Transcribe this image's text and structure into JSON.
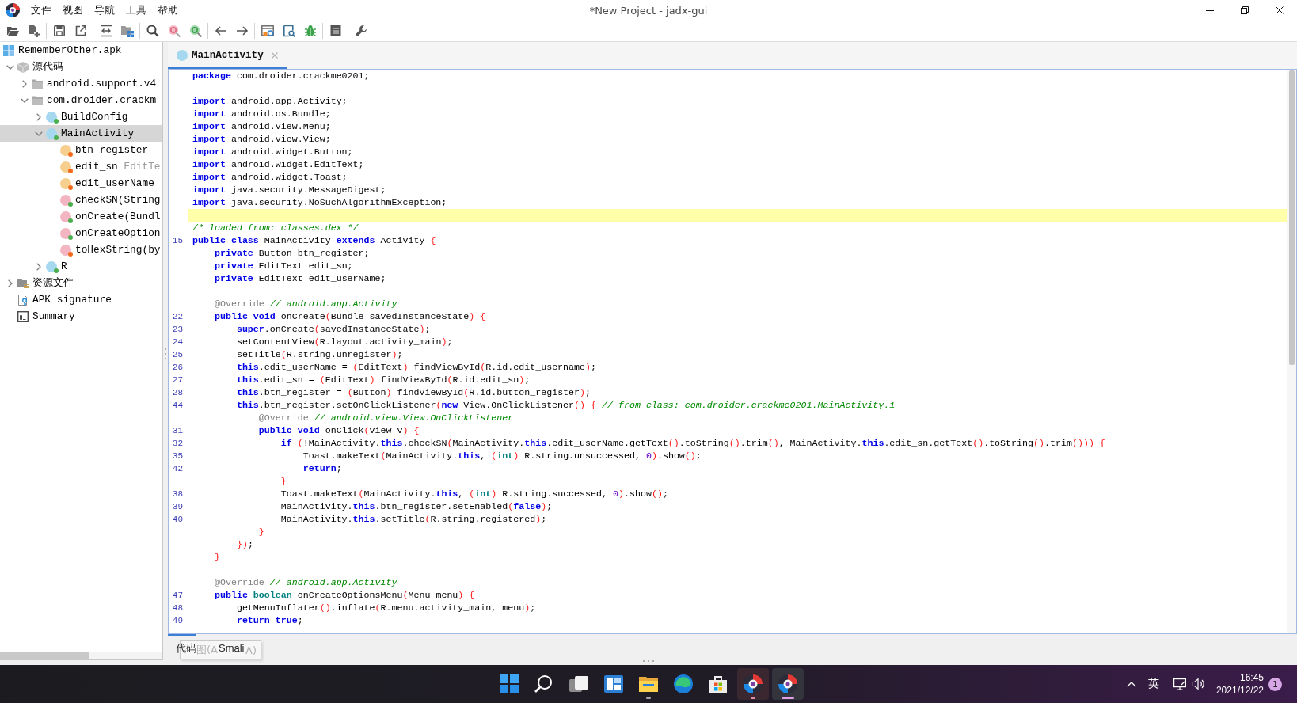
{
  "window": {
    "title": "*New Project - jadx-gui"
  },
  "menu": [
    "文件",
    "视图",
    "导航",
    "工具",
    "帮助"
  ],
  "sidebar": {
    "tree": [
      {
        "label": "RememberOther.apk",
        "kind": "apk",
        "selected": false,
        "children": [
          {
            "label": "源代码",
            "kind": "sources",
            "expanded": true,
            "selected": false,
            "children": [
              {
                "label": "android.support.v4",
                "kind": "package",
                "expanded": false,
                "selected": false
              },
              {
                "label": "com.droider.crackm",
                "kind": "package",
                "expanded": true,
                "selected": false,
                "children": [
                  {
                    "label": "BuildConfig",
                    "kind": "class",
                    "expanded": false,
                    "selected": false,
                    "color": "#4caf50"
                  },
                  {
                    "label": "MainActivity",
                    "kind": "class",
                    "expanded": true,
                    "selected": true,
                    "color": "#4caf50",
                    "children": [
                      {
                        "label": "btn_register",
                        "kind": "field",
                        "selected": false,
                        "color": "#f26b1d"
                      },
                      {
                        "label": "edit_sn",
                        "type": "EditTe",
                        "kind": "field",
                        "selected": false,
                        "color": "#f26b1d"
                      },
                      {
                        "label": "edit_userName",
                        "kind": "field",
                        "selected": false,
                        "color": "#f26b1d"
                      },
                      {
                        "label": "checkSN(String",
                        "kind": "method",
                        "selected": false,
                        "color": "#4caf50"
                      },
                      {
                        "label": "onCreate(Bundl",
                        "kind": "method",
                        "selected": false,
                        "color": "#4caf50"
                      },
                      {
                        "label": "onCreateOption",
                        "kind": "method",
                        "selected": false,
                        "color": "#4caf50"
                      },
                      {
                        "label": "toHexString(by",
                        "kind": "method",
                        "selected": false,
                        "color": "#f26b1d"
                      }
                    ]
                  },
                  {
                    "label": "R",
                    "kind": "class",
                    "expanded": false,
                    "selected": false,
                    "color": "#4caf50"
                  }
                ]
              }
            ]
          },
          {
            "label": "资源文件",
            "kind": "resources",
            "expanded": false,
            "selected": false
          },
          {
            "label": "APK signature",
            "kind": "signature",
            "selected": false
          },
          {
            "label": "Summary",
            "kind": "summary",
            "selected": false
          }
        ]
      }
    ]
  },
  "editor": {
    "tabs": [
      {
        "label": "MainActivity",
        "kind": "class",
        "selected": true
      }
    ],
    "lines": [
      {
        "current": false,
        "tokens": [
          {
            "kind": "keyword",
            "text": "package"
          },
          {
            "kind": "plain",
            "text": " com.droider.crackme0201;"
          }
        ]
      },
      {
        "current": false
      },
      {
        "current": false,
        "tokens": [
          {
            "kind": "keyword",
            "text": "import"
          },
          {
            "kind": "plain",
            "text": " android.app.Activity;"
          }
        ]
      },
      {
        "current": false,
        "tokens": [
          {
            "kind": "keyword",
            "text": "import"
          },
          {
            "kind": "plain",
            "text": " android.os.Bundle;"
          }
        ]
      },
      {
        "current": false,
        "tokens": [
          {
            "kind": "keyword",
            "text": "import"
          },
          {
            "kind": "plain",
            "text": " android.view.Menu;"
          }
        ]
      },
      {
        "current": false,
        "tokens": [
          {
            "kind": "keyword",
            "text": "import"
          },
          {
            "kind": "plain",
            "text": " android.view.View;"
          }
        ]
      },
      {
        "current": false,
        "tokens": [
          {
            "kind": "keyword",
            "text": "import"
          },
          {
            "kind": "plain",
            "text": " android.widget.Button;"
          }
        ]
      },
      {
        "current": false,
        "tokens": [
          {
            "kind": "keyword",
            "text": "import"
          },
          {
            "kind": "plain",
            "text": " android.widget.EditText;"
          }
        ]
      },
      {
        "current": false,
        "tokens": [
          {
            "kind": "keyword",
            "text": "import"
          },
          {
            "kind": "plain",
            "text": " android.widget.Toast;"
          }
        ]
      },
      {
        "current": false,
        "tokens": [
          {
            "kind": "keyword",
            "text": "import"
          },
          {
            "kind": "plain",
            "text": " java.security.MessageDigest;"
          }
        ]
      },
      {
        "current": false,
        "tokens": [
          {
            "kind": "keyword",
            "text": "import"
          },
          {
            "kind": "plain",
            "text": " java.security.NoSuchAlgorithmException;"
          }
        ]
      },
      {
        "current": true
      },
      {
        "current": false,
        "tokens": [
          {
            "kind": "comment",
            "text": "/* loaded from: classes.dex */"
          }
        ]
      },
      {
        "number": "15",
        "current": false,
        "tokens": [
          {
            "kind": "keyword",
            "text": "public"
          },
          {
            "kind": "keyword",
            "text": " class"
          },
          {
            "kind": "plain",
            "text": " MainActivity "
          },
          {
            "kind": "keyword",
            "text": "extends"
          },
          {
            "kind": "plain",
            "text": " Activity "
          },
          {
            "kind": "paren",
            "text": "{"
          }
        ]
      },
      {
        "current": false,
        "tokens": [
          {
            "kind": "keyword",
            "text": "    private"
          },
          {
            "kind": "plain",
            "text": " Button btn_register;"
          }
        ]
      },
      {
        "current": false,
        "tokens": [
          {
            "kind": "keyword",
            "text": "    private"
          },
          {
            "kind": "plain",
            "text": " EditText edit_sn;"
          }
        ]
      },
      {
        "current": false,
        "tokens": [
          {
            "kind": "keyword",
            "text": "    private"
          },
          {
            "kind": "plain",
            "text": " EditText edit_userName;"
          }
        ]
      },
      {
        "current": false
      },
      {
        "current": false,
        "tokens": [
          {
            "kind": "annotation",
            "text": "    @Override"
          },
          {
            "kind": "comment",
            "text": " // android.app.Activity"
          }
        ]
      },
      {
        "number": "22",
        "current": false,
        "tokens": [
          {
            "kind": "keyword",
            "text": "    public"
          },
          {
            "kind": "keyword",
            "text": " void"
          },
          {
            "kind": "plain",
            "text": " onCreate"
          },
          {
            "kind": "paren",
            "text": "("
          },
          {
            "kind": "plain",
            "text": "Bundle savedInstanceState"
          },
          {
            "kind": "paren",
            "text": ")"
          },
          {
            "kind": "paren",
            "text": " {"
          }
        ]
      },
      {
        "number": "23",
        "current": false,
        "tokens": [
          {
            "kind": "keyword",
            "text": "        super"
          },
          {
            "kind": "plain",
            "text": ".onCreate"
          },
          {
            "kind": "paren",
            "text": "("
          },
          {
            "kind": "plain",
            "text": "savedInstanceState"
          },
          {
            "kind": "paren",
            "text": ")"
          },
          {
            "kind": "plain",
            "text": ";"
          }
        ]
      },
      {
        "number": "24",
        "current": false,
        "tokens": [
          {
            "kind": "plain",
            "text": "        setContentView"
          },
          {
            "kind": "paren",
            "text": "("
          },
          {
            "kind": "plain",
            "text": "R.layout.activity_main"
          },
          {
            "kind": "paren",
            "text": ")"
          },
          {
            "kind": "plain",
            "text": ";"
          }
        ]
      },
      {
        "number": "25",
        "current": false,
        "tokens": [
          {
            "kind": "plain",
            "text": "        setTitle"
          },
          {
            "kind": "paren",
            "text": "("
          },
          {
            "kind": "plain",
            "text": "R.string.unregister"
          },
          {
            "kind": "paren",
            "text": ")"
          },
          {
            "kind": "plain",
            "text": ";"
          }
        ]
      },
      {
        "number": "26",
        "current": false,
        "tokens": [
          {
            "kind": "keyword",
            "text": "        this"
          },
          {
            "kind": "plain",
            "text": ".edit_userName = "
          },
          {
            "kind": "paren",
            "text": "("
          },
          {
            "kind": "plain",
            "text": "EditText"
          },
          {
            "kind": "paren",
            "text": ")"
          },
          {
            "kind": "plain",
            "text": " findViewById"
          },
          {
            "kind": "paren",
            "text": "("
          },
          {
            "kind": "plain",
            "text": "R.id.edit_username"
          },
          {
            "kind": "paren",
            "text": ")"
          },
          {
            "kind": "plain",
            "text": ";"
          }
        ]
      },
      {
        "number": "27",
        "current": false,
        "tokens": [
          {
            "kind": "keyword",
            "text": "        this"
          },
          {
            "kind": "plain",
            "text": ".edit_sn = "
          },
          {
            "kind": "paren",
            "text": "("
          },
          {
            "kind": "plain",
            "text": "EditText"
          },
          {
            "kind": "paren",
            "text": ")"
          },
          {
            "kind": "plain",
            "text": " findViewById"
          },
          {
            "kind": "paren",
            "text": "("
          },
          {
            "kind": "plain",
            "text": "R.id.edit_sn"
          },
          {
            "kind": "paren",
            "text": ")"
          },
          {
            "kind": "plain",
            "text": ";"
          }
        ]
      },
      {
        "number": "28",
        "current": false,
        "tokens": [
          {
            "kind": "keyword",
            "text": "        this"
          },
          {
            "kind": "plain",
            "text": ".btn_register = "
          },
          {
            "kind": "paren",
            "text": "("
          },
          {
            "kind": "plain",
            "text": "Button"
          },
          {
            "kind": "paren",
            "text": ")"
          },
          {
            "kind": "plain",
            "text": " findViewById"
          },
          {
            "kind": "paren",
            "text": "("
          },
          {
            "kind": "plain",
            "text": "R.id.button_register"
          },
          {
            "kind": "paren",
            "text": ")"
          },
          {
            "kind": "plain",
            "text": ";"
          }
        ]
      },
      {
        "number": "44",
        "current": false,
        "tokens": [
          {
            "kind": "keyword",
            "text": "        this"
          },
          {
            "kind": "plain",
            "text": ".btn_register.setOnClickListener"
          },
          {
            "kind": "paren",
            "text": "("
          },
          {
            "kind": "keyword",
            "text": "new"
          },
          {
            "kind": "plain",
            "text": " View.OnClickListener"
          },
          {
            "kind": "paren",
            "text": "()"
          },
          {
            "kind": "paren",
            "text": " {"
          },
          {
            "kind": "comment",
            "text": " // from class: com.droider.crackme0201.MainActivity.1"
          }
        ]
      },
      {
        "current": false,
        "tokens": [
          {
            "kind": "annotation",
            "text": "            @Override"
          },
          {
            "kind": "comment",
            "text": " // android.view.View.OnClickListener"
          }
        ]
      },
      {
        "number": "31",
        "current": false,
        "tokens": [
          {
            "kind": "keyword",
            "text": "            public"
          },
          {
            "kind": "keyword",
            "text": " void"
          },
          {
            "kind": "plain",
            "text": " onClick"
          },
          {
            "kind": "paren",
            "text": "("
          },
          {
            "kind": "plain",
            "text": "View v"
          },
          {
            "kind": "paren",
            "text": ")"
          },
          {
            "kind": "paren",
            "text": " {"
          }
        ]
      },
      {
        "number": "32",
        "current": false,
        "tokens": [
          {
            "kind": "keyword",
            "text": "                if"
          },
          {
            "kind": "paren",
            "text": " ("
          },
          {
            "kind": "plain",
            "text": "!MainActivity."
          },
          {
            "kind": "keyword",
            "text": "this"
          },
          {
            "kind": "plain",
            "text": ".checkSN"
          },
          {
            "kind": "paren",
            "text": "("
          },
          {
            "kind": "plain",
            "text": "MainActivity."
          },
          {
            "kind": "keyword",
            "text": "this"
          },
          {
            "kind": "plain",
            "text": ".edit_userName.getText"
          },
          {
            "kind": "paren",
            "text": "()"
          },
          {
            "kind": "plain",
            "text": ".toString"
          },
          {
            "kind": "paren",
            "text": "()"
          },
          {
            "kind": "plain",
            "text": ".trim"
          },
          {
            "kind": "paren",
            "text": "()"
          },
          {
            "kind": "plain",
            "text": ", MainActivity."
          },
          {
            "kind": "keyword",
            "text": "this"
          },
          {
            "kind": "plain",
            "text": ".edit_sn.getText"
          },
          {
            "kind": "paren",
            "text": "()"
          },
          {
            "kind": "plain",
            "text": ".toString"
          },
          {
            "kind": "paren",
            "text": "()"
          },
          {
            "kind": "plain",
            "text": ".trim"
          },
          {
            "kind": "paren",
            "text": "())) {"
          }
        ]
      },
      {
        "number": "35",
        "current": false,
        "tokens": [
          {
            "kind": "plain",
            "text": "                    Toast.makeText"
          },
          {
            "kind": "paren",
            "text": "("
          },
          {
            "kind": "plain",
            "text": "MainActivity."
          },
          {
            "kind": "keyword",
            "text": "this"
          },
          {
            "kind": "plain",
            "text": ", "
          },
          {
            "kind": "paren",
            "text": "("
          },
          {
            "kind": "type",
            "text": "int"
          },
          {
            "kind": "paren",
            "text": ")"
          },
          {
            "kind": "plain",
            "text": " R.string.unsuccessed, "
          },
          {
            "kind": "number",
            "text": "0"
          },
          {
            "kind": "paren",
            "text": ")"
          },
          {
            "kind": "plain",
            "text": ".show"
          },
          {
            "kind": "paren",
            "text": "()"
          },
          {
            "kind": "plain",
            "text": ";"
          }
        ]
      },
      {
        "number": "42",
        "current": false,
        "tokens": [
          {
            "kind": "keyword",
            "text": "                    return"
          },
          {
            "kind": "plain",
            "text": ";"
          }
        ]
      },
      {
        "current": false,
        "tokens": [
          {
            "kind": "paren",
            "text": "                }"
          }
        ]
      },
      {
        "number": "38",
        "current": false,
        "tokens": [
          {
            "kind": "plain",
            "text": "                Toast.makeText"
          },
          {
            "kind": "paren",
            "text": "("
          },
          {
            "kind": "plain",
            "text": "MainActivity."
          },
          {
            "kind": "keyword",
            "text": "this"
          },
          {
            "kind": "plain",
            "text": ", "
          },
          {
            "kind": "paren",
            "text": "("
          },
          {
            "kind": "type",
            "text": "int"
          },
          {
            "kind": "paren",
            "text": ")"
          },
          {
            "kind": "plain",
            "text": " R.string.successed, "
          },
          {
            "kind": "number",
            "text": "0"
          },
          {
            "kind": "paren",
            "text": ")"
          },
          {
            "kind": "plain",
            "text": ".show"
          },
          {
            "kind": "paren",
            "text": "()"
          },
          {
            "kind": "plain",
            "text": ";"
          }
        ]
      },
      {
        "number": "39",
        "current": false,
        "tokens": [
          {
            "kind": "plain",
            "text": "                MainActivity."
          },
          {
            "kind": "keyword",
            "text": "this"
          },
          {
            "kind": "plain",
            "text": ".btn_register.setEnabled"
          },
          {
            "kind": "paren",
            "text": "("
          },
          {
            "kind": "keyword",
            "text": "false"
          },
          {
            "kind": "paren",
            "text": ")"
          },
          {
            "kind": "plain",
            "text": ";"
          }
        ]
      },
      {
        "number": "40",
        "current": false,
        "tokens": [
          {
            "kind": "plain",
            "text": "                MainActivity."
          },
          {
            "kind": "keyword",
            "text": "this"
          },
          {
            "kind": "plain",
            "text": ".setTitle"
          },
          {
            "kind": "paren",
            "text": "("
          },
          {
            "kind": "plain",
            "text": "R.string.registered"
          },
          {
            "kind": "paren",
            "text": ")"
          },
          {
            "kind": "plain",
            "text": ";"
          }
        ]
      },
      {
        "current": false,
        "tokens": [
          {
            "kind": "paren",
            "text": "            }"
          }
        ]
      },
      {
        "current": false,
        "tokens": [
          {
            "kind": "paren",
            "text": "        })"
          },
          {
            "kind": "plain",
            "text": ";"
          }
        ]
      },
      {
        "current": false,
        "tokens": [
          {
            "kind": "paren",
            "text": "    }"
          }
        ]
      },
      {
        "current": false
      },
      {
        "current": false,
        "tokens": [
          {
            "kind": "annotation",
            "text": "    @Override"
          },
          {
            "kind": "comment",
            "text": " // android.app.Activity"
          }
        ]
      },
      {
        "number": "47",
        "current": false,
        "tokens": [
          {
            "kind": "keyword",
            "text": "    public"
          },
          {
            "kind": "type",
            "text": " boolean"
          },
          {
            "kind": "plain",
            "text": " onCreateOptionsMenu"
          },
          {
            "kind": "paren",
            "text": "("
          },
          {
            "kind": "plain",
            "text": "Menu menu"
          },
          {
            "kind": "paren",
            "text": ")"
          },
          {
            "kind": "paren",
            "text": " {"
          }
        ]
      },
      {
        "number": "48",
        "current": false,
        "tokens": [
          {
            "kind": "plain",
            "text": "        getMenuInflater"
          },
          {
            "kind": "paren",
            "text": "()"
          },
          {
            "kind": "plain",
            "text": ".inflate"
          },
          {
            "kind": "paren",
            "text": "("
          },
          {
            "kind": "plain",
            "text": "R.menu.activity_main, menu"
          },
          {
            "kind": "paren",
            "text": ")"
          },
          {
            "kind": "plain",
            "text": ";"
          }
        ]
      },
      {
        "number": "49",
        "current": false,
        "tokens": [
          {
            "kind": "keyword",
            "text": "        return"
          },
          {
            "kind": "keyword",
            "text": " true"
          },
          {
            "kind": "plain",
            "text": ";"
          }
        ]
      }
    ]
  },
  "view_tabs": [
    {
      "label": "代码",
      "selected": true
    },
    {
      "label": "Smali",
      "selected": false
    }
  ],
  "tooltip": {
    "texts": [
      "图(A",
      "A)"
    ]
  },
  "taskbar": {
    "items": [
      {
        "kind": "start",
        "running": false,
        "hovered": false,
        "selected": false
      },
      {
        "kind": "search",
        "running": false,
        "hovered": false,
        "selected": false
      },
      {
        "kind": "task_view",
        "running": false,
        "hovered": false,
        "selected": false
      },
      {
        "kind": "widgets",
        "running": false,
        "hovered": false,
        "selected": false
      },
      {
        "kind": "explorer",
        "running": true,
        "hovered": false,
        "selected": false
      },
      {
        "kind": "browser",
        "running": false,
        "hovered": false,
        "selected": false
      },
      {
        "kind": "store",
        "running": false,
        "hovered": false,
        "selected": false
      },
      {
        "kind": "jadx",
        "running": true,
        "hovered": true,
        "selected": false
      },
      {
        "kind": "jadx",
        "running": true,
        "hovered": false,
        "selected": true
      }
    ],
    "tray": {
      "input_method": "英",
      "time": "16:45",
      "date": "2021/12/22",
      "notifications": "1"
    }
  }
}
